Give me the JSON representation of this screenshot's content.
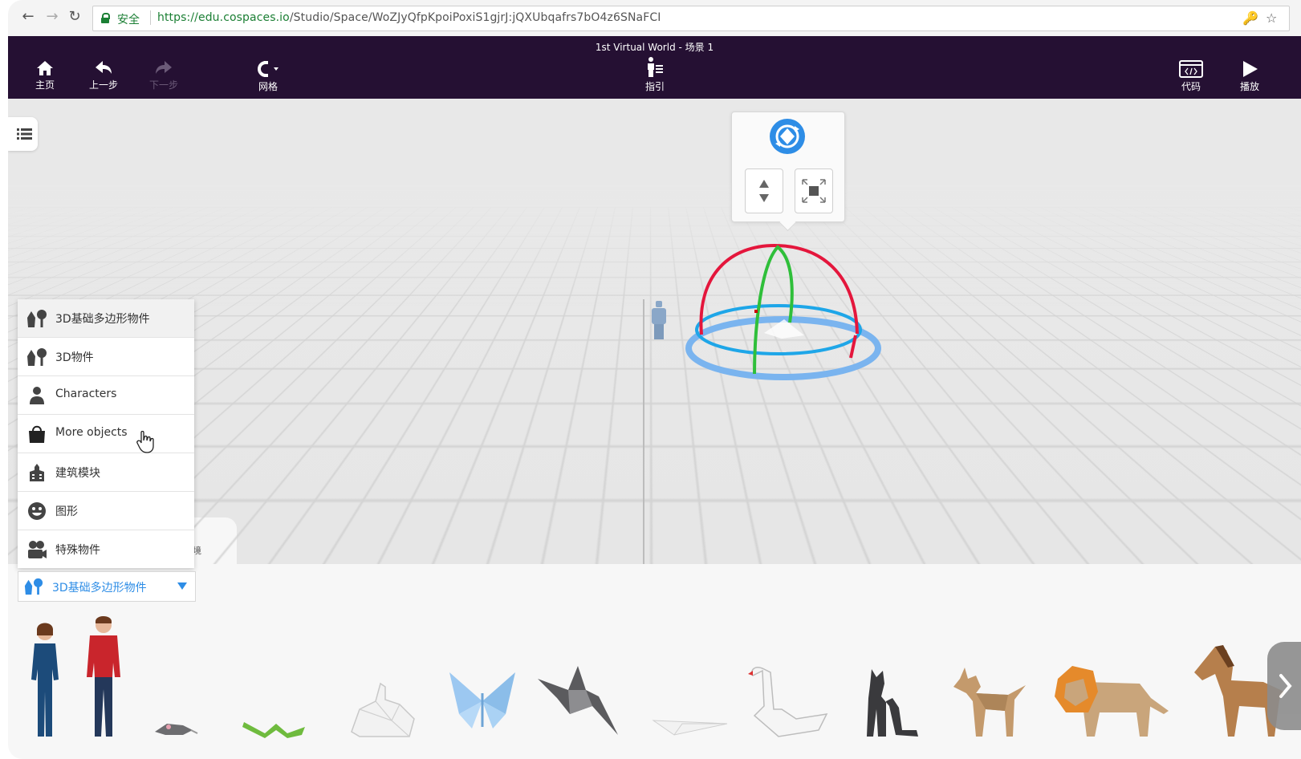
{
  "browser": {
    "secure_label": "安全",
    "url_scheme_host": "https://edu.cospaces.io",
    "url_path": "/Studio/Space/WoZJyQfpKpoiPoxiS1gjrJ:jQXUbqafrs7bO4z6SNaFCI"
  },
  "toolbar": {
    "scene_title": "1st Virtual World - 场景 1",
    "home_label": "主页",
    "undo_label": "上一步",
    "redo_label": "下一步",
    "grid_label": "网格",
    "guide_label": "指引",
    "code_label": "代码",
    "play_label": "播放"
  },
  "category_menu": {
    "items": [
      {
        "label": "3D基础多边形物件",
        "icon": "tree-rocket-icon"
      },
      {
        "label": "3D物件",
        "icon": "tree-rocket-icon"
      },
      {
        "label": "Characters",
        "icon": "person-icon"
      },
      {
        "label": "More objects",
        "icon": "shopping-bag-icon"
      },
      {
        "label": "建筑模块",
        "icon": "building-icon"
      },
      {
        "label": "图形",
        "icon": "smiley-icon"
      },
      {
        "label": "特殊物件",
        "icon": "camera-icon"
      }
    ],
    "hovered_index": 3,
    "selected_label": "3D基础多边形物件"
  },
  "drawer": {
    "partial_tab_label": "境",
    "items": [
      "woman",
      "man",
      "rat",
      "snake",
      "rabbit",
      "butterfly",
      "crane",
      "plane",
      "swan",
      "cat",
      "dog",
      "lion",
      "horse"
    ]
  },
  "colors": {
    "toolbar_bg": "#251033",
    "accent_blue": "#2e8de6",
    "secure_green": "#1b7f34",
    "gizmo_red": "#e4163c",
    "gizmo_green": "#2fbf3a",
    "gizmo_blue": "#1ea6e8"
  }
}
